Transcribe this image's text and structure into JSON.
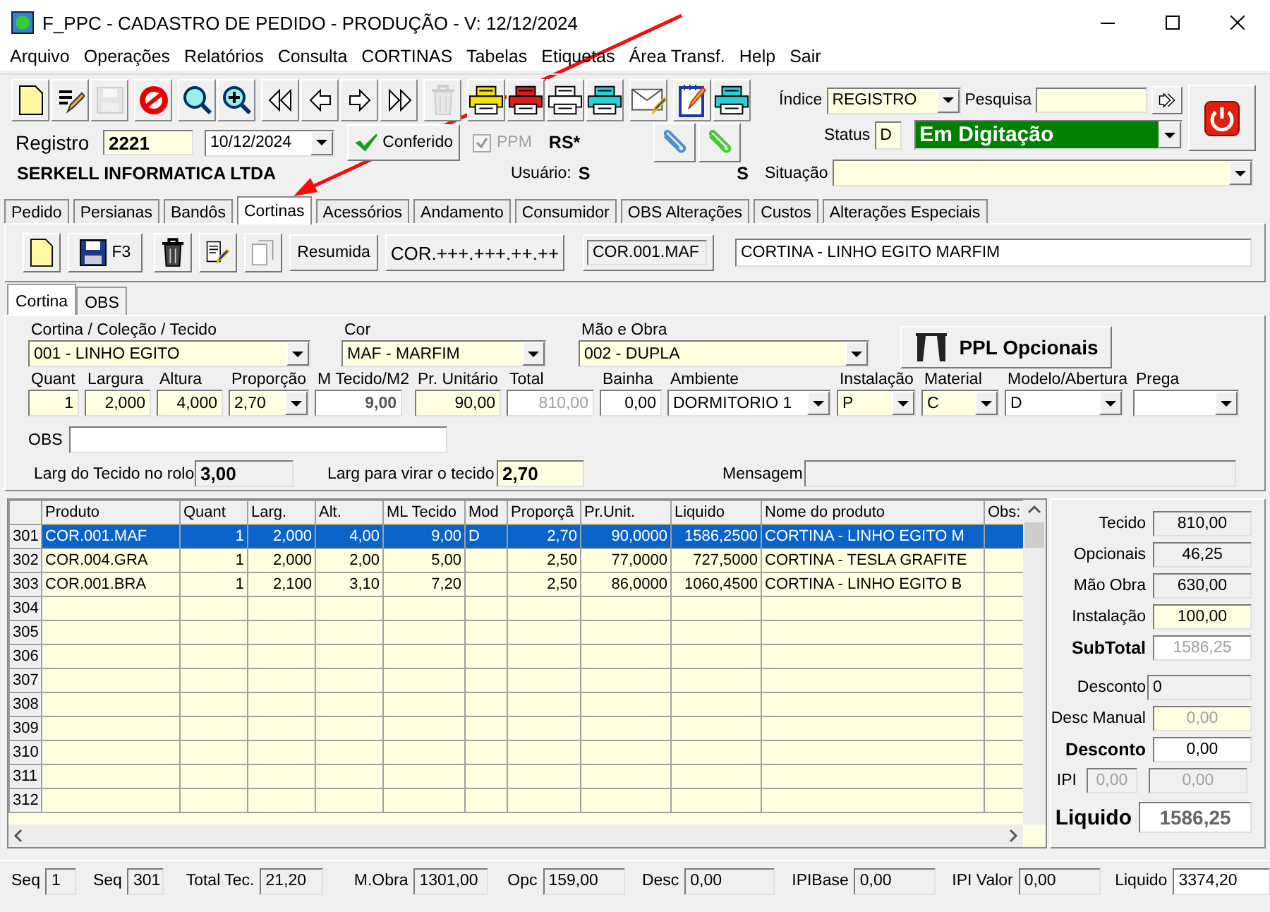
{
  "window": {
    "title": "F_PPC - CADASTRO DE PEDIDO - PRODUÇÃO - V: 12/12/2024"
  },
  "menu": [
    "Arquivo",
    "Operações",
    "Relatórios",
    "Consulta",
    "CORTINAS",
    "Tabelas",
    "Etiquetas",
    "Área Transf.",
    "Help",
    "Sair"
  ],
  "toolbar": [
    {
      "kind": "document",
      "disabled": false
    },
    {
      "kind": "spell",
      "disabled": false
    },
    {
      "kind": "save",
      "disabled": true
    },
    {
      "kind": "stop",
      "disabled": false
    },
    {
      "kind": "search",
      "disabled": false
    },
    {
      "kind": "zoom",
      "disabled": false
    },
    {
      "kind": "first",
      "disabled": false
    },
    {
      "kind": "prev",
      "disabled": false
    },
    {
      "kind": "next",
      "disabled": false
    },
    {
      "kind": "last",
      "disabled": false
    },
    {
      "kind": "trash",
      "disabled": true
    },
    {
      "kind": "printer",
      "color": "#f5e400",
      "disabled": false
    },
    {
      "kind": "printer",
      "color": "#d81e1e",
      "disabled": false
    },
    {
      "kind": "printer",
      "color": "#ffffff",
      "disabled": false
    },
    {
      "kind": "printer",
      "color": "#2ad0d8",
      "disabled": false
    },
    {
      "kind": "mail",
      "disabled": false
    },
    {
      "kind": "notepad",
      "disabled": false
    },
    {
      "kind": "printer",
      "color": "#2ad0d8",
      "disabled": false
    }
  ],
  "header": {
    "registro_label": "Registro",
    "registro": "2221",
    "date": "10/12/2024",
    "conferido": "Conferido",
    "ppm": {
      "label": "PPM",
      "checked": true,
      "disabled": true
    },
    "currency": "RS*",
    "company": "SERKELL INFORMATICA LTDA",
    "usuario_label": "Usuário:",
    "usuario": "S",
    "user_code": "S",
    "indice_label": "Índice",
    "indice": "REGISTRO",
    "pesquisa_label": "Pesquisa",
    "status_label": "Status",
    "status_code": "D",
    "status": "Em Digitação",
    "situacao_label": "Situação"
  },
  "tabs": [
    {
      "label": "Pedido",
      "selected": false
    },
    {
      "label": "Persianas",
      "selected": false
    },
    {
      "label": "Bandôs",
      "selected": false
    },
    {
      "label": "Cortinas",
      "selected": true
    },
    {
      "label": "Acessórios",
      "selected": false
    },
    {
      "label": "Andamento",
      "selected": false
    },
    {
      "label": "Consumidor",
      "selected": false
    },
    {
      "label": "OBS Alterações",
      "selected": false
    },
    {
      "label": "Custos",
      "selected": false
    },
    {
      "label": "Alterações Especiais",
      "selected": false
    }
  ],
  "cortinas": {
    "save_key": "F3",
    "resumida": "Resumida",
    "mask": "COR.+++.+++.++.++",
    "code": "COR.001.MAF",
    "description": "CORTINA - LINHO EGITO MARFIM"
  },
  "subtabs": [
    {
      "label": "Cortina",
      "selected": true
    },
    {
      "label": "OBS",
      "selected": false
    }
  ],
  "form": {
    "combos": [
      {
        "label": "Cortina / Coleção / Tecido",
        "value": "001 - LINHO EGITO"
      },
      {
        "label": "Cor",
        "value": "MAF - MARFIM"
      },
      {
        "label": "Mão e Obra",
        "value": "002 - DUPLA"
      }
    ],
    "ppl_button": "PPL Opcionais",
    "fields": [
      {
        "label": "Quant",
        "value": "1",
        "kind": "input"
      },
      {
        "label": "Largura",
        "value": "2,000",
        "kind": "input"
      },
      {
        "label": "Altura",
        "value": "4,000",
        "kind": "input"
      },
      {
        "label": "Proporção",
        "value": "2,70",
        "kind": "combo"
      },
      {
        "label": "M Tecido/M2",
        "value": "9,00",
        "kind": "readonly"
      },
      {
        "label": "Pr. Unitário",
        "value": "90,00",
        "kind": "input"
      },
      {
        "label": "Total",
        "value": "810,00",
        "kind": "disabled"
      },
      {
        "label": "Bainha",
        "value": "0,00",
        "kind": "white"
      },
      {
        "label": "Ambiente",
        "value": "DORMITORIO 1",
        "kind": "whitecombo"
      },
      {
        "label": "Instalação",
        "value": "P",
        "kind": "combo"
      },
      {
        "label": "Material",
        "value": "C",
        "kind": "combo"
      },
      {
        "label": "Modelo/Abertura",
        "value": "D",
        "kind": "whitecombo"
      },
      {
        "label": "Prega",
        "kind": "whitecombo"
      }
    ],
    "obs_label": "OBS",
    "larg_rolo_label": "Larg do Tecido no rolo",
    "larg_rolo": "3,00",
    "larg_virar_label": "Larg para virar o tecido",
    "larg_virar": "2,70",
    "mensagem_label": "Mensagem"
  },
  "table": {
    "columns": [
      "Produto",
      "Quant",
      "Larg.",
      "Alt.",
      "ML Tecido",
      "Mod",
      "Proporçã",
      "Pr.Unit.",
      "Liquido",
      "Nome do produto",
      "Obs:"
    ],
    "rows": [
      {
        "row": "301",
        "selected": true,
        "cells": [
          "COR.001.MAF",
          "1",
          "2,000",
          "4,00",
          "9,00",
          "D",
          "2,70",
          "90,0000",
          "1586,2500",
          "CORTINA - LINHO EGITO M",
          ""
        ]
      },
      {
        "row": "302",
        "selected": false,
        "cells": [
          "COR.004.GRA",
          "1",
          "2,000",
          "2,00",
          "5,00",
          "",
          "2,50",
          "77,0000",
          "727,5000",
          "CORTINA - TESLA GRAFITE",
          ""
        ]
      },
      {
        "row": "303",
        "selected": false,
        "cells": [
          "COR.001.BRA",
          "1",
          "2,100",
          "3,10",
          "7,20",
          "",
          "2,50",
          "86,0000",
          "1060,4500",
          "CORTINA - LINHO EGITO B",
          ""
        ]
      },
      {
        "row": "304",
        "selected": false
      },
      {
        "row": "305",
        "selected": false
      },
      {
        "row": "306",
        "selected": false
      },
      {
        "row": "307",
        "selected": false
      },
      {
        "row": "308",
        "selected": false
      },
      {
        "row": "309",
        "selected": false
      },
      {
        "row": "310",
        "selected": false
      },
      {
        "row": "311",
        "selected": false
      },
      {
        "row": "312",
        "selected": false
      }
    ]
  },
  "totals": [
    {
      "label": "Tecido",
      "value": "810,00",
      "kind": "readonly"
    },
    {
      "label": "Opcionais",
      "value": "46,25",
      "kind": "readonly"
    },
    {
      "label": "Mão Obra",
      "value": "630,00",
      "kind": "readonly"
    },
    {
      "label": "Instalação",
      "value": "100,00",
      "kind": "input"
    },
    {
      "label": "SubTotal",
      "value": "1586,25",
      "kind": "subtotal"
    },
    {
      "label": "Desconto",
      "value": "0",
      "kind": "left"
    },
    {
      "label": "Desc Manual",
      "value": "0,00",
      "kind": "input-disabled"
    },
    {
      "label": "Desconto",
      "value": "0,00",
      "kind": "bold"
    },
    {
      "label": "IPI",
      "value": "0,00",
      "value2": "0,00",
      "kind": "ipi"
    },
    {
      "label": "Liquido",
      "value": "1586,25",
      "kind": "grand"
    }
  ],
  "status_bar": [
    {
      "label": "Seq",
      "value": "1"
    },
    {
      "label": "Seq",
      "value": "301"
    },
    {
      "label": "Total Tec.",
      "value": "21,20"
    },
    {
      "label": "M.Obra",
      "value": "1301,00"
    },
    {
      "label": "Opc",
      "value": "159,00"
    },
    {
      "label": "Desc",
      "value": "0,00"
    },
    {
      "label": "IPIBase",
      "value": "0,00"
    },
    {
      "label": "IPI Valor",
      "value": "0,00"
    },
    {
      "label": "Liquido",
      "value": "3374,20",
      "kind": "white"
    }
  ]
}
